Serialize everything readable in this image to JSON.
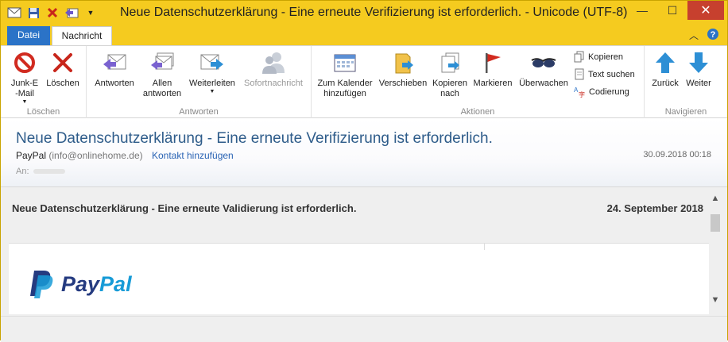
{
  "window": {
    "title": "Neue Datenschutzerklärung - Eine erneute Verifizierung ist erforderlich. - Unicode (UTF-8)",
    "controls": {
      "minimize": "—",
      "maximize": "☐",
      "close": "✕"
    }
  },
  "tabs": [
    {
      "label": "Datei"
    },
    {
      "label": "Nachricht"
    }
  ],
  "ribbon": {
    "groups": {
      "loeschen": "Löschen",
      "antworten": "Antworten",
      "aktionen": "Aktionen",
      "navigieren": "Navigieren"
    },
    "buttons": {
      "junk_line1": "Junk-E",
      "junk_line2": "-Mail",
      "delete": "Löschen",
      "reply": "Antworten",
      "reply_all_line1": "Allen",
      "reply_all_line2": "antworten",
      "forward": "Weiterleiten",
      "instant_message": "Sofortnachricht",
      "calendar_line1": "Zum Kalender",
      "calendar_line2": "hinzufügen",
      "move": "Verschieben",
      "copy_to_line1": "Kopieren",
      "copy_to_line2": "nach",
      "flag": "Markieren",
      "watch": "Überwachen",
      "copy": "Kopieren",
      "find_text": "Text suchen",
      "encoding": "Codierung",
      "back": "Zurück",
      "next": "Weiter"
    }
  },
  "message": {
    "subject": "Neue Datenschutzerklärung - Eine erneute Verifizierung ist erforderlich.",
    "sender_name": "PayPal",
    "sender_address": "(info@onlinehome.de)",
    "add_contact": "Kontakt hinzufügen",
    "date": "30.09.2018 00:18",
    "to_label": "An:"
  },
  "body": {
    "heading": "Neue Datenschutzerklärung - Eine erneute Validierung ist erforderlich.",
    "date": "24. September 2018",
    "logo_text_a": "Pay",
    "logo_text_b": "Pal"
  },
  "colors": {
    "titlebar": "#f5cb1f",
    "file_tab": "#2b73c7",
    "subject": "#2e5c8a",
    "paypal_dark": "#253b80",
    "paypal_light": "#179bd7"
  }
}
